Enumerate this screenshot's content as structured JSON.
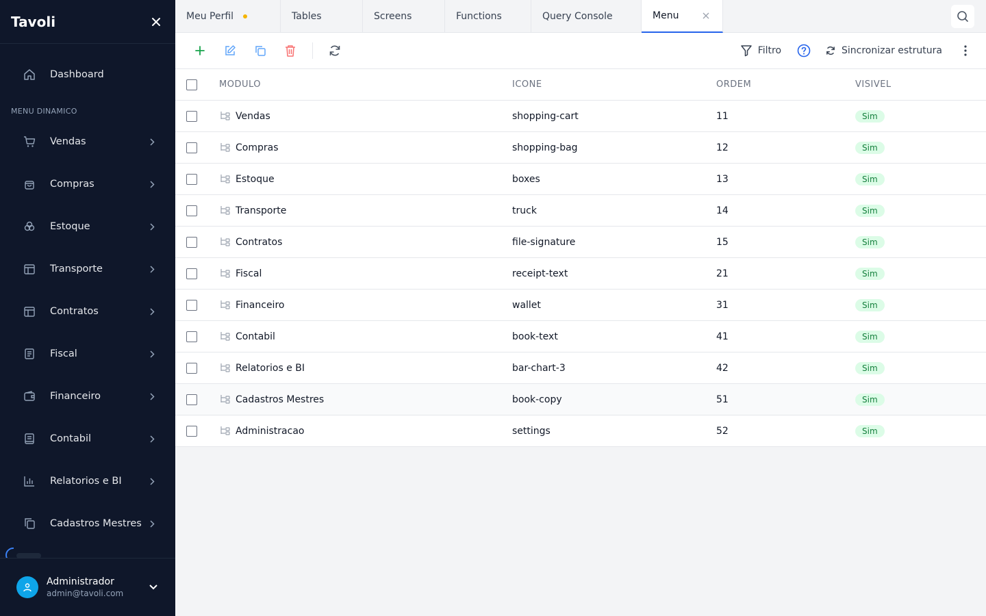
{
  "app": {
    "name": "Tavoli"
  },
  "sidebar": {
    "dashboard": "Dashboard",
    "section_title": "MENU DINAMICO",
    "items": [
      {
        "label": "Vendas",
        "icon": "shopping-cart-icon"
      },
      {
        "label": "Compras",
        "icon": "shopping-bag-icon"
      },
      {
        "label": "Estoque",
        "icon": "boxes-icon"
      },
      {
        "label": "Transporte",
        "icon": "truck-icon"
      },
      {
        "label": "Contratos",
        "icon": "file-signature-icon"
      },
      {
        "label": "Fiscal",
        "icon": "receipt-text-icon"
      },
      {
        "label": "Financeiro",
        "icon": "wallet-icon"
      },
      {
        "label": "Contabil",
        "icon": "book-text-icon"
      },
      {
        "label": "Relatorios e BI",
        "icon": "bar-chart-icon"
      },
      {
        "label": "Cadastros Mestres",
        "icon": "book-copy-icon"
      }
    ]
  },
  "user": {
    "name": "Administrador",
    "email": "admin@tavoli.com"
  },
  "tabs": [
    {
      "label": "Meu Perfil",
      "modified": true
    },
    {
      "label": "Tables"
    },
    {
      "label": "Screens"
    },
    {
      "label": "Functions"
    },
    {
      "label": "Query Console"
    },
    {
      "label": "Menu",
      "active": true
    }
  ],
  "toolbar": {
    "filter_label": "Filtro",
    "sync_label": "Sincronizar estrutura"
  },
  "table": {
    "headers": {
      "modulo": "MODULO",
      "icone": "ICONE",
      "ordem": "ORDEM",
      "visivel": "VISIVEL"
    },
    "rows": [
      {
        "modulo": "Vendas",
        "icone": "shopping-cart",
        "ordem": "11",
        "visivel": "Sim"
      },
      {
        "modulo": "Compras",
        "icone": "shopping-bag",
        "ordem": "12",
        "visivel": "Sim"
      },
      {
        "modulo": "Estoque",
        "icone": "boxes",
        "ordem": "13",
        "visivel": "Sim"
      },
      {
        "modulo": "Transporte",
        "icone": "truck",
        "ordem": "14",
        "visivel": "Sim"
      },
      {
        "modulo": "Contratos",
        "icone": "file-signature",
        "ordem": "15",
        "visivel": "Sim"
      },
      {
        "modulo": "Fiscal",
        "icone": "receipt-text",
        "ordem": "21",
        "visivel": "Sim"
      },
      {
        "modulo": "Financeiro",
        "icone": "wallet",
        "ordem": "31",
        "visivel": "Sim"
      },
      {
        "modulo": "Contabil",
        "icone": "book-text",
        "ordem": "41",
        "visivel": "Sim"
      },
      {
        "modulo": "Relatorios e BI",
        "icone": "bar-chart-3",
        "ordem": "42",
        "visivel": "Sim"
      },
      {
        "modulo": "Cadastros Mestres",
        "icone": "book-copy",
        "ordem": "51",
        "visivel": "Sim"
      },
      {
        "modulo": "Administracao",
        "icone": "settings",
        "ordem": "52",
        "visivel": "Sim"
      }
    ]
  }
}
